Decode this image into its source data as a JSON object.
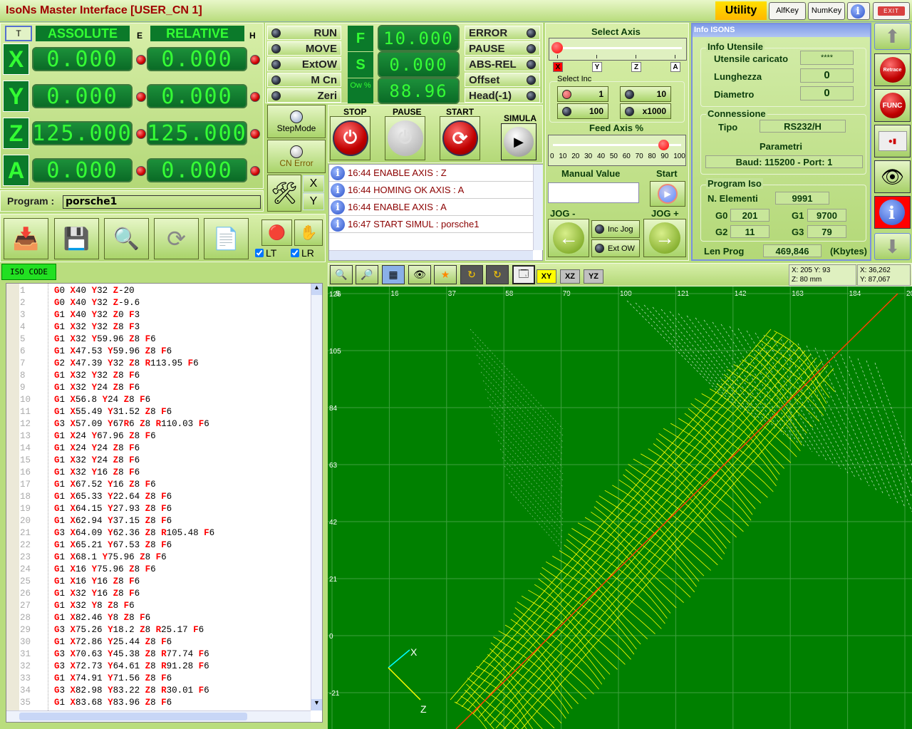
{
  "title": "IsoNs Master Interface [USER_CN 1]",
  "topbar": {
    "utility": "Utility",
    "alfkey": "AlfKey",
    "numkey": "NumKey",
    "info": "i",
    "exit": "EXIT"
  },
  "dro": {
    "t_label": "T",
    "abs_label": "ASSOLUTE",
    "e_label": "E",
    "rel_label": "RELATIVE",
    "h_label": "H",
    "axes": [
      {
        "name": "X",
        "abs": "0.000",
        "rel": "0.000"
      },
      {
        "name": "Y",
        "abs": "0.000",
        "rel": "0.000"
      },
      {
        "name": "Z",
        "abs": "125.000",
        "rel": "125.000"
      },
      {
        "name": "A",
        "abs": "0.000",
        "rel": "0.000"
      }
    ]
  },
  "program": {
    "label": "Program :",
    "value": "porsche1"
  },
  "status_left": [
    "RUN",
    "MOVE",
    "ExtOW",
    "M Cn",
    "Zeri"
  ],
  "fs": {
    "f_label": "F",
    "f_value": "10.000",
    "s_label": "S",
    "s_value": "0.000",
    "ow_label": "Ow %",
    "ow_value": "88.96"
  },
  "status_right": [
    "ERROR",
    "PAUSE",
    "ABS-REL",
    "Offset",
    "Head(-1)"
  ],
  "side_buttons": {
    "stepmode": "StepMode",
    "cnerror": "CN Error",
    "x": "X",
    "y": "Y"
  },
  "controls": {
    "stop": "STOP",
    "pause": "PAUSE",
    "start": "START",
    "simula": "SIMULA"
  },
  "log": [
    {
      "text": "16:44 ENABLE AXIS : Z"
    },
    {
      "text": "16:44 HOMING OK AXIS : A"
    },
    {
      "text": "16:44 ENABLE AXIS : A"
    },
    {
      "text": "16:47 START SIMUL : porsche1"
    }
  ],
  "jog": {
    "select_axis": "Select Axis",
    "axes": [
      "X",
      "Y",
      "Z",
      "A"
    ],
    "selected_axis": "X",
    "select_inc": "Select Inc",
    "incs": [
      "1",
      "10",
      "100",
      "x1000"
    ],
    "selected_inc": "1",
    "feed_label": "Feed Axis %",
    "feed_ticks": [
      "0",
      "10",
      "20",
      "30",
      "40",
      "50",
      "60",
      "70",
      "80",
      "90",
      "100"
    ],
    "feed_value": 85,
    "manual_value_label": "Manual Value",
    "manual_value": "",
    "start_label": "Start",
    "jog_minus": "JOG -",
    "jog_plus": "JOG +",
    "inc_jog": "Inc Jog",
    "ext_ow": "Ext OW"
  },
  "info_panel": {
    "title": "Info ISONS",
    "utensile_title": "Info Utensile",
    "caricato_label": "Utensile caricato",
    "caricato": "****",
    "lunghezza_label": "Lunghezza",
    "lunghezza": "0",
    "diametro_label": "Diametro",
    "diametro": "0",
    "conn_title": "Connessione",
    "tipo_label": "Tipo",
    "tipo": "RS232/H",
    "param_label": "Parametri",
    "param": "Baud: 115200 - Port: 1",
    "iso_title": "Program Iso",
    "nel_label": "N. Elementi",
    "nel": "9991",
    "g0_label": "G0",
    "g0": "201",
    "g1_label": "G1",
    "g1": "9700",
    "g2_label": "G2",
    "g2": "11",
    "g3_label": "G3",
    "g3": "79",
    "len_label": "Len Prog",
    "len": "469,846",
    "len_unit": "(Kbytes)"
  },
  "right_buttons": {
    "retrace": "Retrace",
    "func": "FUNC",
    "info": "i"
  },
  "toolbar": {
    "lt": "LT",
    "lr": "LR",
    "lt_checked": true,
    "lr_checked": true
  },
  "iso_tab": "ISO CODE",
  "code": [
    "G0 X40 Y32 Z-20",
    "G0 X40 Y32 Z-9.6",
    "G1 X40 Y32 Z0 F3",
    "G1 X32 Y32 Z8 F3",
    "G1 X32 Y59.96 Z8 F6",
    "G1 X47.53 Y59.96 Z8 F6",
    "G2 X47.39 Y32 Z8 R113.95 F6",
    "G1 X32 Y32 Z8 F6",
    "G1 X32 Y24 Z8 F6",
    "G1 X56.8 Y24 Z8 F6",
    "G1 X55.49 Y31.52 Z8 F6",
    "G3 X57.09 Y67R6 Z8 R110.03 F6",
    "G1 X24 Y67.96 Z8 F6",
    "G1 X24 Y24 Z8 F6",
    "G1 X32 Y24 Z8 F6",
    "G1 X32 Y16 Z8 F6",
    "G1 X67.52 Y16 Z8 F6",
    "G1 X65.33 Y22.64 Z8 F6",
    "G1 X64.15 Y27.93 Z8 F6",
    "G1 X62.94 Y37.15 Z8 F6",
    "G3 X64.09 Y62.36 Z8 R105.48 F6",
    "G1 X65.21 Y67.53 Z8 F6",
    "G1 X68.1 Y75.96 Z8 F6",
    "G1 X16 Y75.96 Z8 F6",
    "G1 X16 Y16 Z8 F6",
    "G1 X32 Y16 Z8 F6",
    "G1 X32 Y8 Z8 F6",
    "G1 X82.46 Y8 Z8 F6",
    "G3 X75.26 Y18.2 Z8 R25.17 F6",
    "G1 X72.86 Y25.44 Z8 F6",
    "G3 X70.63 Y45.38 Z8 R77.74 F6",
    "G3 X72.73 Y64.61 Z8 R91.28 F6",
    "G1 X74.91 Y71.56 Z8 F6",
    "G3 X82.98 Y83.22 Z8 R30.01 F6",
    "G1 X83.68 Y83.96 Z8 F6"
  ],
  "viewer": {
    "views": [
      "XY",
      "XZ",
      "YZ"
    ],
    "active_view": "XY",
    "readout1_a": "X: 205 Y: 93",
    "readout1_b": "Z: 80 mm",
    "readout2_a": "X: 36,262",
    "readout2_b": "Y: 87,067",
    "x_ticks": [
      "-5",
      "16",
      "37",
      "58",
      "79",
      "100",
      "121",
      "142",
      "163",
      "184",
      "205"
    ],
    "y_ticks": [
      "126",
      "105",
      "84",
      "63",
      "42",
      "21",
      "0",
      "-21"
    ],
    "axis_x": "X",
    "axis_z": "Z",
    "colors": {
      "background": "#008000",
      "toolpath": "#ffff00",
      "rapid": "#ff4000",
      "grid": "#40a040"
    }
  }
}
